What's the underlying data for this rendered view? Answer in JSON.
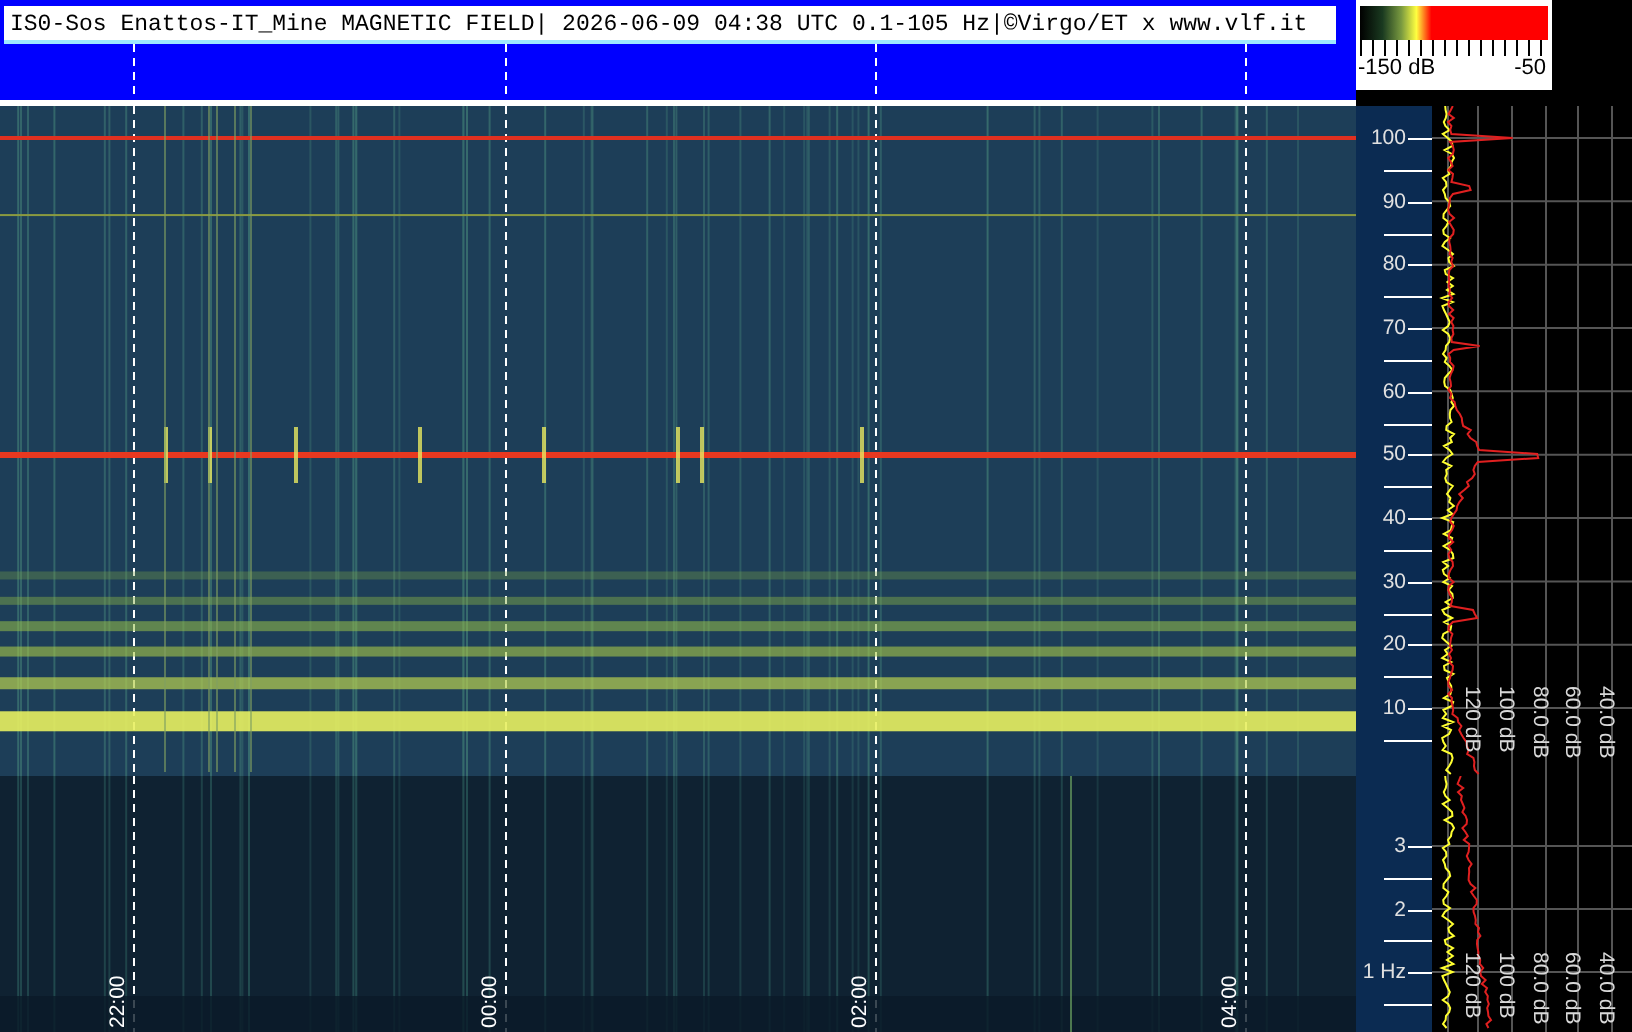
{
  "header": {
    "title": "IS0-Sos Enattos-IT_Mine MAGNETIC FIELD| 2026-06-09 04:38 UTC 0.1-105 Hz|©Virgo/ET x www.vlf.it"
  },
  "colorbar": {
    "min_label": "-150 dB",
    "max_label": "-50"
  },
  "time_axis": {
    "labels": [
      "22:00",
      "00:00",
      "02:00",
      "04:00"
    ]
  },
  "upper_panel": {
    "frequency_labels": [
      "100",
      "90",
      "80",
      "70",
      "60",
      "50",
      "40",
      "30",
      "20",
      "10"
    ],
    "level_labels": [
      "120 dB",
      "100 dB",
      "80.0 dB",
      "60.0 dB",
      "40.0 dB"
    ]
  },
  "lower_panel": {
    "frequency_labels": [
      "3",
      "2",
      "1 Hz"
    ],
    "level_labels": [
      "120 dB",
      "100 dB",
      "80.0 dB",
      "60.0 dB",
      "40.0 dB"
    ]
  }
}
